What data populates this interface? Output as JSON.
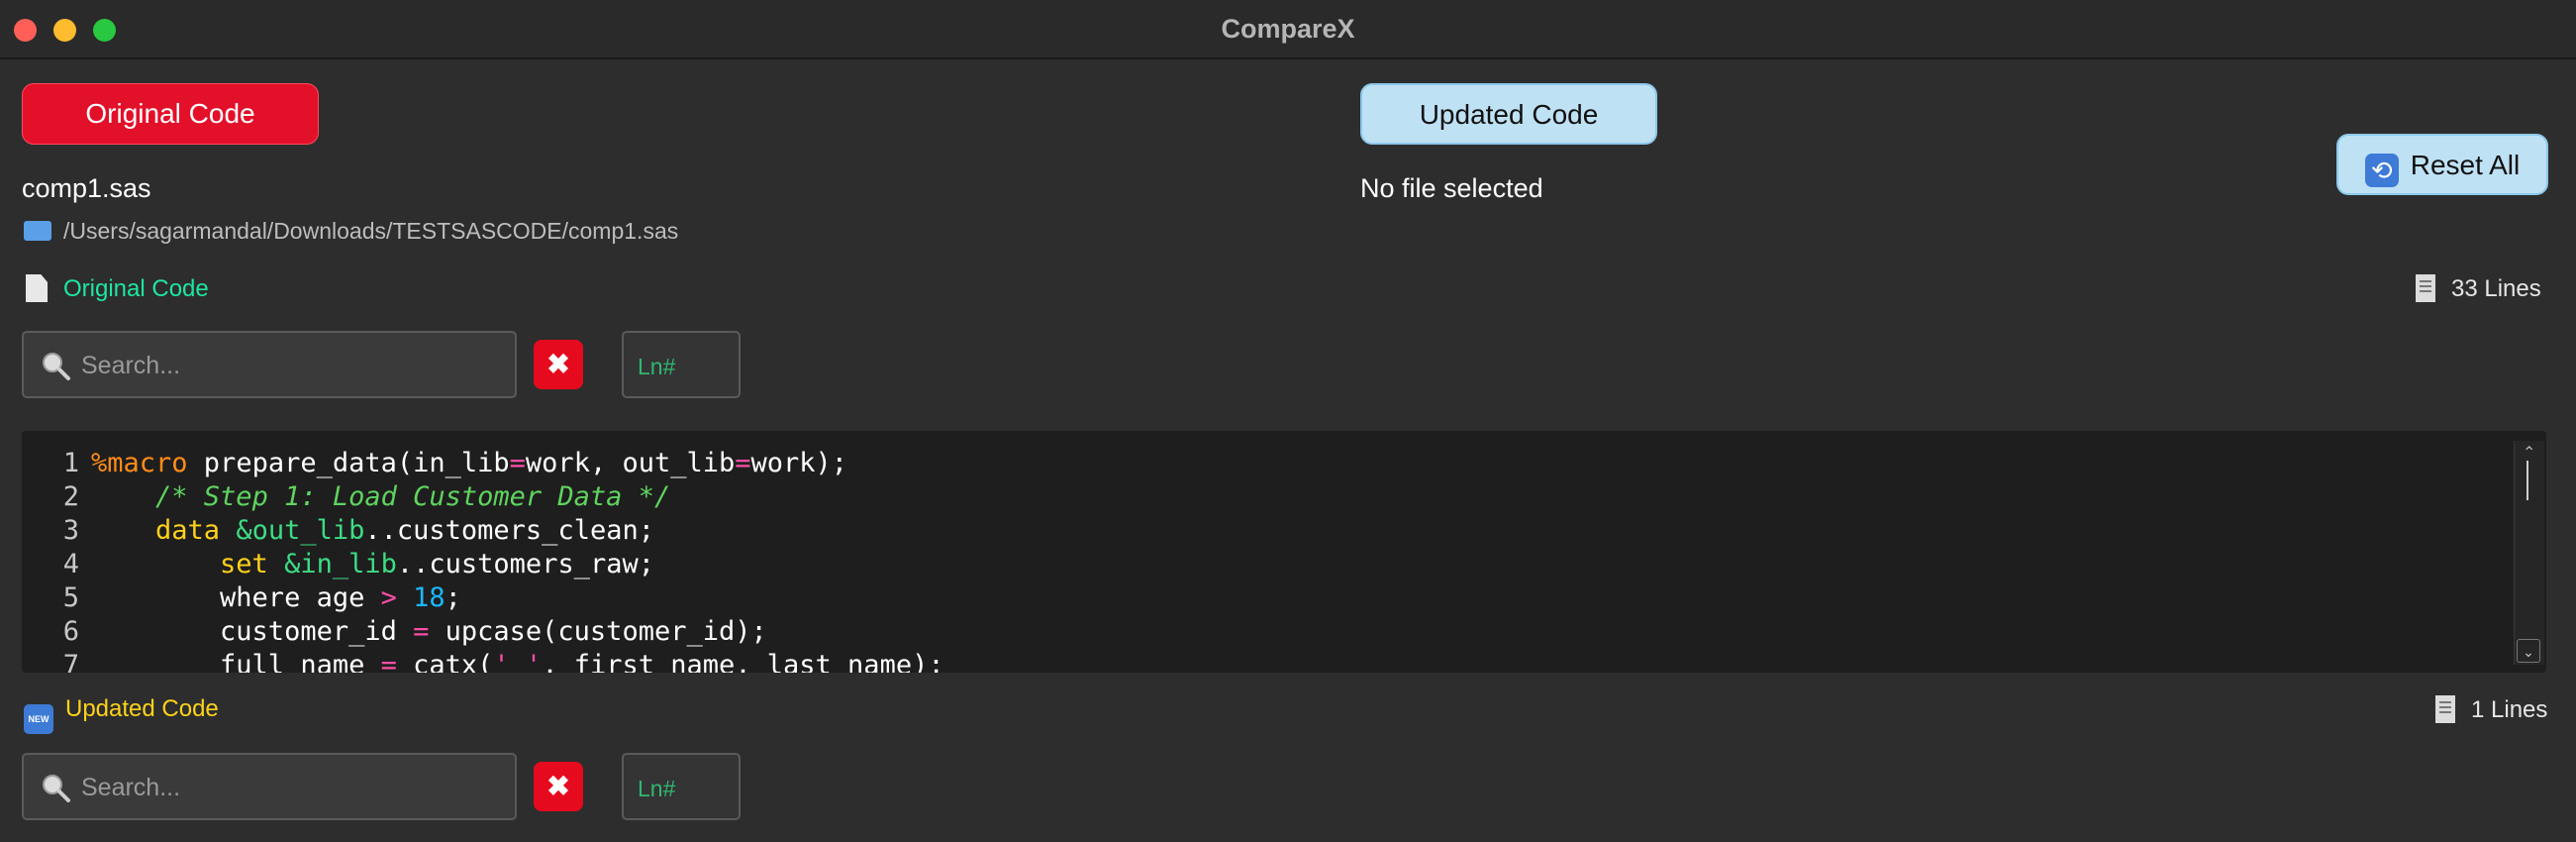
{
  "window": {
    "title": "CompareX"
  },
  "buttons": {
    "original": "Original Code",
    "updated": "Updated Code",
    "reset": "Reset All"
  },
  "original_file": {
    "name": "comp1.sas",
    "path": "/Users/sagarmandal/Downloads/TESTSASCODE/comp1.sas"
  },
  "updated_file": {
    "name": "No file selected"
  },
  "original_section": {
    "label": "Original Code",
    "lines_count": "33 Lines",
    "search_placeholder": "Search...",
    "clear_icon": "✖",
    "line_placeholder": "Ln#"
  },
  "updated_section": {
    "label": "Updated Code",
    "lines_count": "1 Lines",
    "search_placeholder": "Search...",
    "clear_icon": "✖",
    "line_placeholder": "Ln#"
  },
  "code_lines": [
    {
      "n": "1",
      "tokens": [
        [
          "macro",
          "%macro"
        ],
        [
          "plain",
          " prepare_data(in_lib"
        ],
        [
          "op",
          "="
        ],
        [
          "plain",
          "work, out_lib"
        ],
        [
          "op",
          "="
        ],
        [
          "plain",
          "work);"
        ]
      ]
    },
    {
      "n": "2",
      "tokens": [
        [
          "plain",
          "    "
        ],
        [
          "comment",
          "/* Step 1: Load Customer Data */"
        ]
      ]
    },
    {
      "n": "3",
      "tokens": [
        [
          "plain",
          "    "
        ],
        [
          "keyword",
          "data"
        ],
        [
          "plain",
          " "
        ],
        [
          "var",
          "&out_lib"
        ],
        [
          "plain",
          "..customers_clean;"
        ]
      ]
    },
    {
      "n": "4",
      "tokens": [
        [
          "plain",
          "        "
        ],
        [
          "keyword",
          "set"
        ],
        [
          "plain",
          " "
        ],
        [
          "var",
          "&in_lib"
        ],
        [
          "plain",
          "..customers_raw;"
        ]
      ]
    },
    {
      "n": "5",
      "tokens": [
        [
          "plain",
          "        where age "
        ],
        [
          "op",
          ">"
        ],
        [
          "plain",
          " "
        ],
        [
          "number",
          "18"
        ],
        [
          "plain",
          ";"
        ]
      ]
    },
    {
      "n": "6",
      "tokens": [
        [
          "plain",
          "        customer_id "
        ],
        [
          "op",
          "="
        ],
        [
          "plain",
          " upcase(customer_id);"
        ]
      ]
    },
    {
      "n": "7",
      "tokens": [
        [
          "plain",
          "        full_name "
        ],
        [
          "op",
          "="
        ],
        [
          "plain",
          " catx("
        ],
        [
          "string",
          "' '"
        ],
        [
          "plain",
          ", first_name, last_name);"
        ]
      ]
    }
  ],
  "colors": {
    "original_button": "#e3102a",
    "updated_button": "#bfe1f4",
    "original_label": "#1ee6a0",
    "updated_label": "#ffd21a"
  },
  "icons": {
    "folder": "folder-icon",
    "document": "document-icon",
    "new": "new-badge-icon",
    "receipt": "receipt-icon",
    "search": "magnifier-icon",
    "clear": "clear-x-icon",
    "reset": "refresh-icon"
  }
}
